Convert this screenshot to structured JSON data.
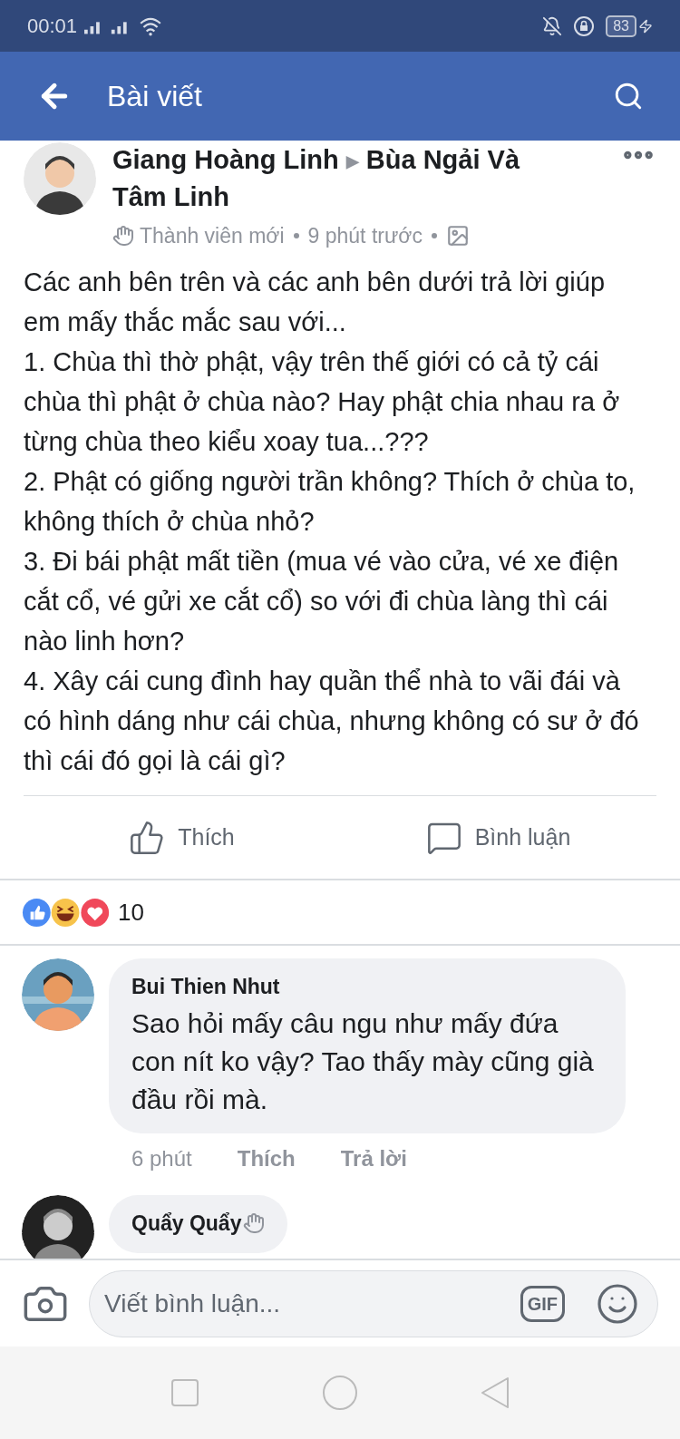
{
  "status_bar": {
    "time": "00:01",
    "battery": "83"
  },
  "header": {
    "title": "Bài viết"
  },
  "post": {
    "author": "Giang Hoàng Linh",
    "separator": "▶",
    "group": "Bùa Ngải Và Tâm Linh",
    "badge": "Thành viên mới",
    "time": "9 phút trước",
    "text": "Các anh bên trên và các anh bên dưới trả lời giúp em mấy thắc mắc sau với...\n1. Chùa thì thờ phật, vậy trên thế giới có cả tỷ cái chùa thì phật ở chùa nào? Hay phật chia nhau ra ở từng chùa theo kiểu xoay tua...???\n2. Phật có giống người trần không? Thích ở chùa to, không thích ở chùa nhỏ?\n3. Đi bái phật mất tiền (mua vé vào cửa, vé xe điện cắt cổ, vé gửi xe cắt cổ) so với đi chùa làng thì cái nào linh hơn?\n4. Xây cái cung đình hay quần thể nhà to vãi đái và có hình dáng như cái chùa, nhưng không có sư ở đó thì cái đó gọi là cái gì?",
    "actions": [
      {
        "label": "Thích",
        "kind": "like"
      },
      {
        "label": "Bình luận",
        "kind": "comment"
      }
    ]
  },
  "reactions": {
    "count": "10"
  },
  "comments": [
    {
      "name": "Bui Thien Nhut",
      "new_member": false,
      "text": "Sao hỏi mấy câu ngu như mấy đứa con nít ko vậy? Tao thấy mày cũng già đầu rồi mà.",
      "time": "6 phút",
      "actions": [
        "Thích",
        "Trả lời"
      ]
    },
    {
      "name": "Quẩy Quẩy",
      "new_member": true
    }
  ],
  "composer": {
    "placeholder": "Viết bình luận...",
    "gif": "GIF"
  }
}
